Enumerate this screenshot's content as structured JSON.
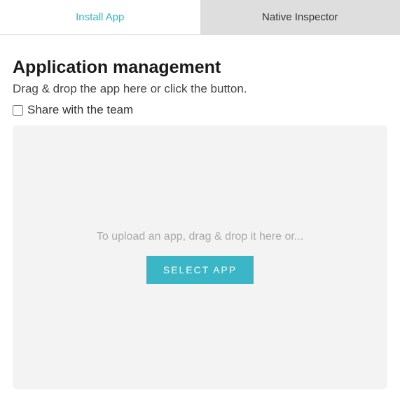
{
  "tabs": {
    "install": "Install App",
    "inspector": "Native Inspector"
  },
  "heading": "Application management",
  "subheading": "Drag & drop the app here or click the button.",
  "share_label": "Share with the team",
  "drop_text": "To upload an app, drag & drop it here or...",
  "select_button": "SELECT APP"
}
